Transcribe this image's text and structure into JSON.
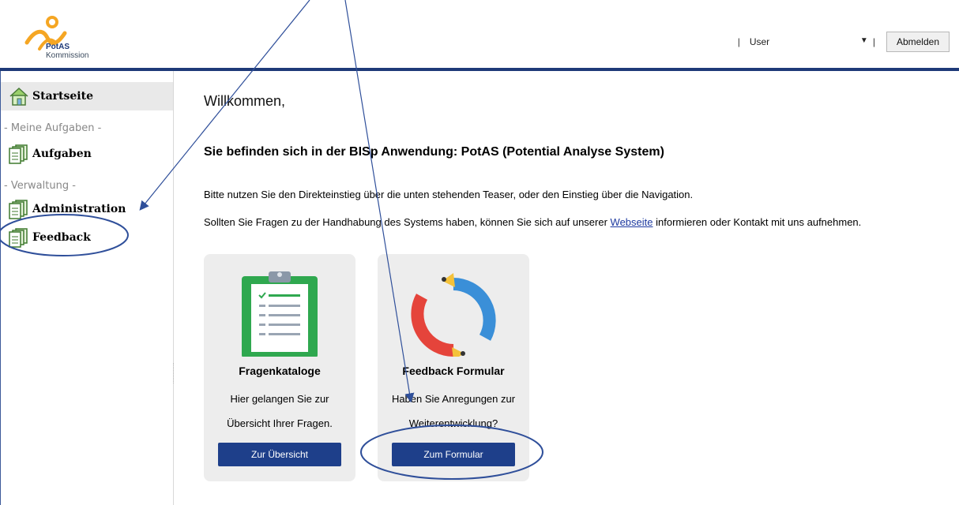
{
  "header": {
    "logo_name": "PotAS",
    "logo_sub": "Kommission",
    "user_label": "User",
    "separator": "|",
    "logout_label": "Abmelden"
  },
  "sidebar": {
    "home_label": "Startseite",
    "section_tasks": "- Meine Aufgaben -",
    "tasks_label": "Aufgaben",
    "section_admin": "- Verwaltung -",
    "admin_label": "Administration",
    "feedback_label": "Feedback"
  },
  "main": {
    "welcome": "Willkommen,",
    "headline": "Sie befinden sich in der BISp Anwendung: PotAS (Potential Analyse System)",
    "para1": "Bitte nutzen Sie den Direkteinstieg über die unten stehenden Teaser, oder den Einstieg über die Navigation.",
    "para2_before": "Sollten Sie Fragen zu der Handhabung des Systems haben, können Sie sich auf unserer ",
    "para2_link": "Webseite",
    "para2_after": " informieren oder Kontakt mit uns aufnehmen.",
    "cards": [
      {
        "title": "Fragenkataloge",
        "desc1": "Hier gelangen Sie zur",
        "desc2": "Übersicht Ihrer Fragen.",
        "button": "Zur Übersicht",
        "icon": "clipboard-icon"
      },
      {
        "title": "Feedback Formular",
        "desc1": "Haben Sie Anregungen zur",
        "desc2": "Weiterentwicklung?",
        "button": "Zum Formular",
        "icon": "pencil-cycle-icon"
      }
    ]
  },
  "colors": {
    "accent": "#1e3f8a",
    "logo_orange": "#f5a623",
    "annotation": "#2f4f9a"
  }
}
